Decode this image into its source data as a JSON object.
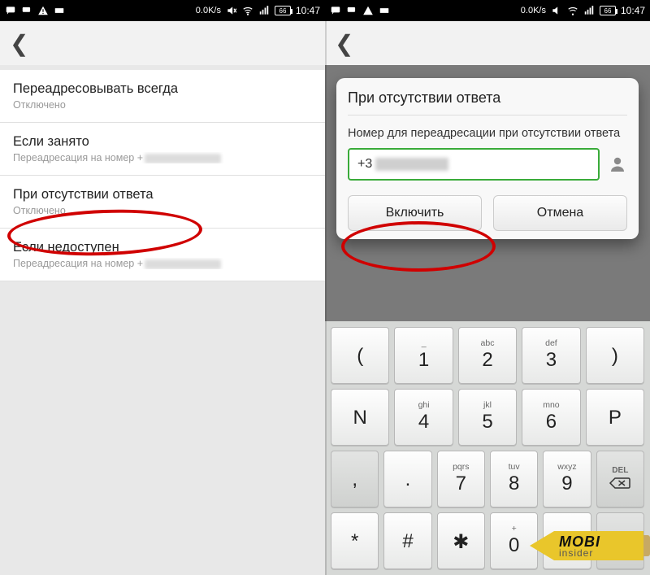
{
  "statusbar": {
    "speed": "0.0K/s",
    "battery": "66",
    "time": "10:47"
  },
  "left": {
    "items": [
      {
        "title": "Переадресовывать всегда",
        "sub": "Отключено",
        "redir": false
      },
      {
        "title": "Если занято",
        "sub": "Переадресация на номер +",
        "redir": true
      },
      {
        "title": "При отсутствии ответа",
        "sub": "Отключено",
        "redir": false
      },
      {
        "title": "Если недоступен",
        "sub": "Переадресация на номер +",
        "redir": true
      }
    ]
  },
  "right": {
    "dialog_title": "При отсутствии ответа",
    "dialog_label": "Номер для переадресации при отсутствии ответа",
    "input_prefix": "+3",
    "btn_enable": "Включить",
    "btn_cancel": "Отмена"
  },
  "keyboard": {
    "rows": [
      [
        {
          "top": "",
          "main": "("
        },
        {
          "top": "_",
          "main": "1"
        },
        {
          "top": "abc",
          "main": "2"
        },
        {
          "top": "def",
          "main": "3"
        },
        {
          "top": "",
          "main": ")"
        }
      ],
      [
        {
          "top": "",
          "main": "N"
        },
        {
          "top": "ghi",
          "main": "4"
        },
        {
          "top": "jkl",
          "main": "5"
        },
        {
          "top": "mno",
          "main": "6"
        },
        {
          "top": "",
          "main": "P"
        }
      ],
      [
        {
          "top": "",
          "main": ",",
          "dark": true
        },
        {
          "top": "",
          "main": "."
        },
        {
          "top": "pqrs",
          "main": "7"
        },
        {
          "top": "tuv",
          "main": "8"
        },
        {
          "top": "wxyz",
          "main": "9"
        },
        {
          "top": "DEL",
          "main": "DEL",
          "del": true,
          "dark": true
        }
      ],
      [
        {
          "top": "",
          "main": "*"
        },
        {
          "top": "",
          "main": "#"
        },
        {
          "top": "",
          "main": "✱"
        },
        {
          "top": "+",
          "main": "0"
        },
        {
          "top": "",
          "main": "_"
        },
        {
          "top": "",
          "main": "CHECK",
          "dark": true
        }
      ]
    ]
  },
  "watermark": {
    "top": "MOBI",
    "bot": "insider"
  }
}
